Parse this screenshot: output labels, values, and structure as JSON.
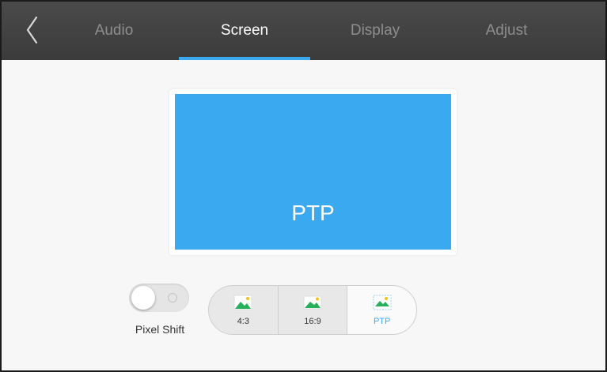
{
  "nav": {
    "back_icon": "chevron-left-icon",
    "tabs": [
      {
        "label": "Audio",
        "active": false
      },
      {
        "label": "Screen",
        "active": true
      },
      {
        "label": "Display",
        "active": false
      },
      {
        "label": "Adjust",
        "active": false
      }
    ]
  },
  "preview": {
    "label": "PTP"
  },
  "pixel_shift": {
    "label": "Pixel Shift",
    "enabled": false
  },
  "aspect": {
    "options": [
      {
        "label": "4:3",
        "icon": "image-icon",
        "selected": false
      },
      {
        "label": "16:9",
        "icon": "image-icon",
        "selected": false
      },
      {
        "label": "PTP",
        "icon": "image-ptp-icon",
        "selected": true
      }
    ]
  },
  "colors": {
    "accent": "#3aa9f0",
    "topbar": "#3f3f3f",
    "tab_inactive": "#8e8e8e",
    "tab_active": "#ffffff",
    "image_icon_green": "#27b05a"
  }
}
